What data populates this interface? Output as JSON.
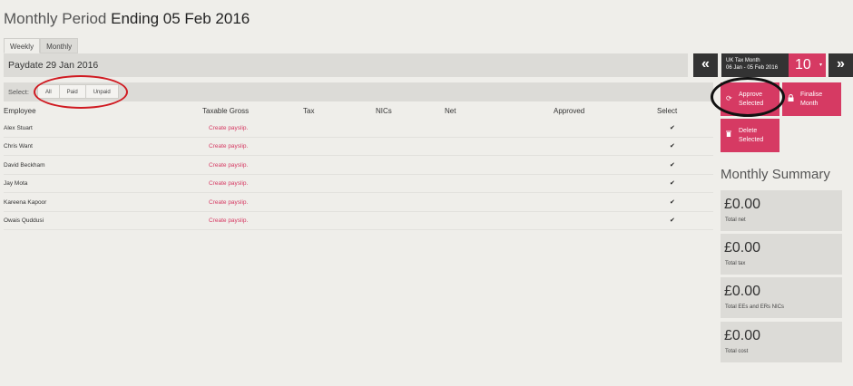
{
  "page": {
    "title_prefix": "Monthly Period",
    "title_strong": "Ending 05 Feb 2016"
  },
  "tabs": [
    {
      "label": "Weekly",
      "active": true
    },
    {
      "label": "Monthly",
      "active": false
    }
  ],
  "paydate": "Paydate 29 Jan 2016",
  "nav": {
    "prev_label": "«",
    "next_label": "»",
    "tax_month_title": "UK Tax Month",
    "tax_month_range": "06 Jan - 05 Feb 2016",
    "month_number": "10",
    "caret": "▾"
  },
  "select_bar": {
    "label": "Select:",
    "options": [
      "All",
      "Paid",
      "Unpaid"
    ]
  },
  "table": {
    "headers": {
      "employee": "Employee",
      "taxable_gross": "Taxable Gross",
      "tax": "Tax",
      "nics": "NICs",
      "net": "Net",
      "approved": "Approved",
      "select": "Select"
    },
    "rows": [
      {
        "employee": "Alex Stuart",
        "action": "Create payslip.",
        "selected": true
      },
      {
        "employee": "Chris Want",
        "action": "Create payslip.",
        "selected": true
      },
      {
        "employee": "David Beckham",
        "action": "Create payslip.",
        "selected": true
      },
      {
        "employee": "Jay Mota",
        "action": "Create payslip.",
        "selected": true
      },
      {
        "employee": "Kareena Kapoor",
        "action": "Create payslip.",
        "selected": true
      },
      {
        "employee": "Owais Quddusi",
        "action": "Create payslip.",
        "selected": true
      }
    ],
    "check_glyph": "✔"
  },
  "actions": {
    "approve_line1": "Approve",
    "approve_line2": "Selected",
    "finalise_line1": "Finalise",
    "finalise_line2": "Month",
    "delete_line1": "Delete",
    "delete_line2": "Selected"
  },
  "summary": {
    "title": "Monthly Summary",
    "cards": [
      {
        "amount": "£0.00",
        "caption": "Total net"
      },
      {
        "amount": "£0.00",
        "caption": "Total tax"
      },
      {
        "amount": "£0.00",
        "caption": "Total EEs and ERs NICs"
      },
      {
        "amount": "£0.00",
        "caption": "Total cost"
      }
    ]
  },
  "colors": {
    "accent": "#d63a63",
    "dark": "#333333",
    "background": "#efeeea",
    "panel": "#dcdbd7",
    "annotation_red": "#d01a21"
  }
}
